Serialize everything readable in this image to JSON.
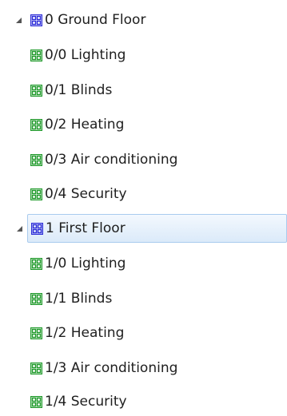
{
  "colors": {
    "group_icon_blue": "#2b2bd8",
    "group_icon_green": "#1f9a2a",
    "selection_border": "#a9cbee",
    "selection_fill": "#dbeaf9",
    "expander": "#555555"
  },
  "tree": {
    "floors": [
      {
        "label": "0 Ground Floor",
        "expanded": true,
        "selected": false,
        "icon": "group-grid-icon",
        "children": [
          {
            "label": "0/0 Lighting",
            "icon": "group-grid-icon"
          },
          {
            "label": "0/1 Blinds",
            "icon": "group-grid-icon"
          },
          {
            "label": "0/2 Heating",
            "icon": "group-grid-icon"
          },
          {
            "label": "0/3 Air conditioning",
            "icon": "group-grid-icon"
          },
          {
            "label": "0/4 Security",
            "icon": "group-grid-icon"
          }
        ]
      },
      {
        "label": "1 First Floor",
        "expanded": true,
        "selected": true,
        "icon": "group-grid-icon",
        "children": [
          {
            "label": "1/0 Lighting",
            "icon": "group-grid-icon"
          },
          {
            "label": "1/1 Blinds",
            "icon": "group-grid-icon"
          },
          {
            "label": "1/2 Heating",
            "icon": "group-grid-icon"
          },
          {
            "label": "1/3 Air conditioning",
            "icon": "group-grid-icon"
          },
          {
            "label": "1/4 Security",
            "icon": "group-grid-icon"
          }
        ]
      }
    ]
  }
}
